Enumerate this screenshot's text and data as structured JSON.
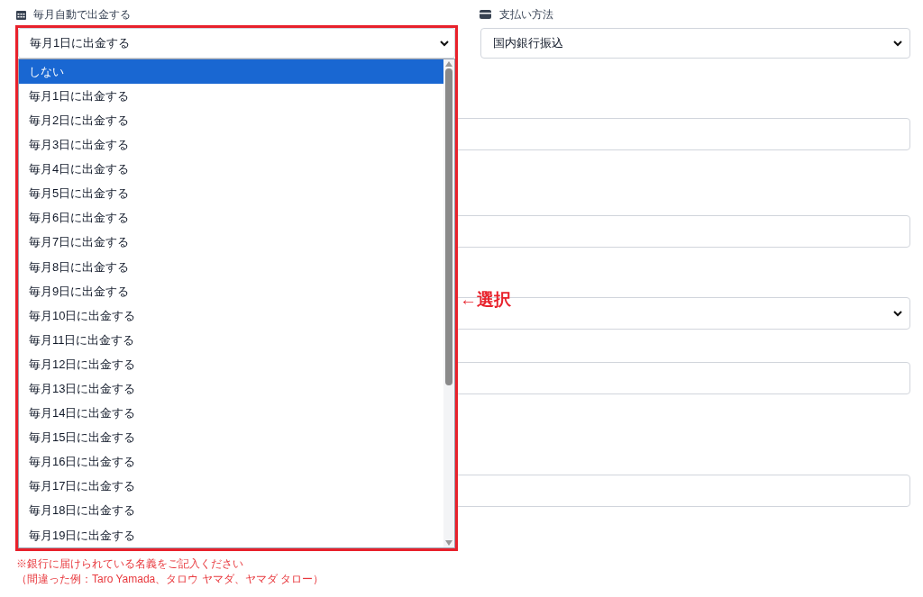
{
  "auto_withdraw": {
    "label": "毎月自動で出金する",
    "value": "毎月1日に出金する",
    "expanded": true,
    "options": [
      {
        "label": "しない",
        "highlighted": true
      },
      {
        "label": "毎月1日に出金する",
        "highlighted": false
      },
      {
        "label": "毎月2日に出金する",
        "highlighted": false
      },
      {
        "label": "毎月3日に出金する",
        "highlighted": false
      },
      {
        "label": "毎月4日に出金する",
        "highlighted": false
      },
      {
        "label": "毎月5日に出金する",
        "highlighted": false
      },
      {
        "label": "毎月6日に出金する",
        "highlighted": false
      },
      {
        "label": "毎月7日に出金する",
        "highlighted": false
      },
      {
        "label": "毎月8日に出金する",
        "highlighted": false
      },
      {
        "label": "毎月9日に出金する",
        "highlighted": false
      },
      {
        "label": "毎月10日に出金する",
        "highlighted": false
      },
      {
        "label": "毎月11日に出金する",
        "highlighted": false
      },
      {
        "label": "毎月12日に出金する",
        "highlighted": false
      },
      {
        "label": "毎月13日に出金する",
        "highlighted": false
      },
      {
        "label": "毎月14日に出金する",
        "highlighted": false
      },
      {
        "label": "毎月15日に出金する",
        "highlighted": false
      },
      {
        "label": "毎月16日に出金する",
        "highlighted": false
      },
      {
        "label": "毎月17日に出金する",
        "highlighted": false
      },
      {
        "label": "毎月18日に出金する",
        "highlighted": false
      },
      {
        "label": "毎月19日に出金する",
        "highlighted": false
      }
    ]
  },
  "payment_method": {
    "label": "支払い方法",
    "value": "国内銀行振込"
  },
  "background_fields": [
    {
      "kind": "input"
    },
    {
      "kind": "input"
    },
    {
      "kind": "select"
    },
    {
      "kind": "input"
    },
    {
      "kind": "input"
    }
  ],
  "notes": [
    "※銀行に届けられている名義をご記入ください",
    "（間違った例：Taro Yamada、タロウ ヤマダ、ヤマダ タロー）"
  ],
  "annotation": {
    "text": "←選択"
  }
}
